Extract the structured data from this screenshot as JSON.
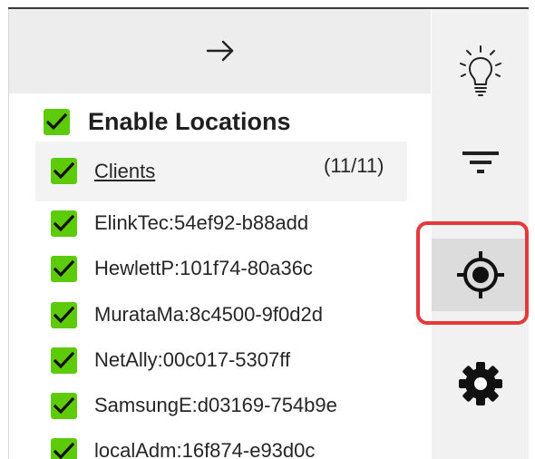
{
  "header": {
    "back_icon": "arrow-right-icon"
  },
  "filter": {
    "enable_label": "Enable Locations",
    "enabled": true,
    "clients": {
      "label": "Clients",
      "count": "(11/11)",
      "checked": true
    },
    "locations": [
      {
        "label": "ElinkTec:54ef92-b88add",
        "checked": true
      },
      {
        "label": "HewlettP:101f74-80a36c",
        "checked": true
      },
      {
        "label": "MurataMa:8c4500-9f0d2d",
        "checked": true
      },
      {
        "label": "NetAlly:00c017-5307ff",
        "checked": true
      },
      {
        "label": "SamsungE:d03169-754b9e",
        "checked": true
      },
      {
        "label": "localAdm:16f874-e93d0c",
        "checked": true
      }
    ]
  },
  "sidebar": {
    "items": [
      {
        "icon": "lightbulb-icon",
        "active": false
      },
      {
        "icon": "filter-icon",
        "active": false
      },
      {
        "icon": "crosshair-location-icon",
        "active": true,
        "highlighted": true
      },
      {
        "icon": "gear-icon",
        "active": false
      }
    ]
  },
  "colors": {
    "checkbox": "#5ecb0a",
    "highlight": "#e5383b",
    "header_bg": "#ededed",
    "sidebar_bg": "#f1f1f1",
    "active_bg": "#dcdcdc"
  }
}
